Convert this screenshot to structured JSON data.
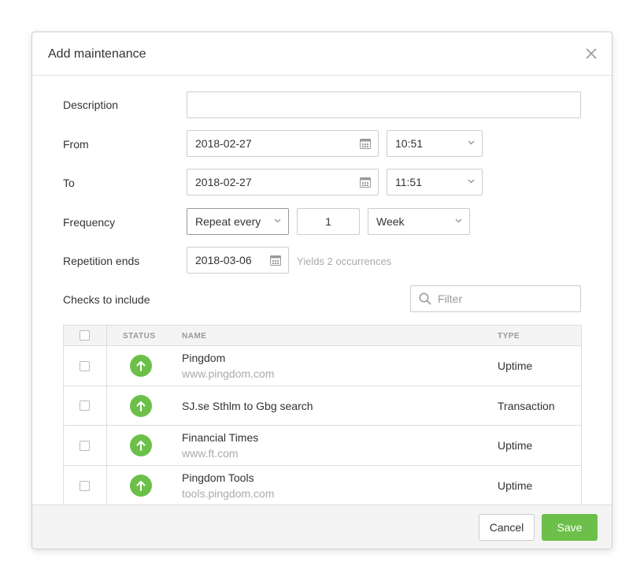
{
  "dialog": {
    "title": "Add maintenance"
  },
  "form": {
    "description": {
      "label": "Description",
      "value": ""
    },
    "from": {
      "label": "From",
      "date": "2018-02-27",
      "time": "10:51"
    },
    "to": {
      "label": "To",
      "date": "2018-02-27",
      "time": "11:51"
    },
    "frequency": {
      "label": "Frequency",
      "mode": "Repeat every",
      "count": "1",
      "unit": "Week"
    },
    "repetition_ends": {
      "label": "Repetition ends",
      "date": "2018-03-06",
      "hint": "Yields 2 occurrences"
    },
    "checks": {
      "label": "Checks to include",
      "filter_placeholder": "Filter"
    }
  },
  "table": {
    "columns": [
      "STATUS",
      "NAME",
      "TYPE"
    ],
    "rows": [
      {
        "name": "Pingdom",
        "url": "www.pingdom.com",
        "type": "Uptime",
        "status": "up"
      },
      {
        "name": "SJ.se Sthlm to Gbg search",
        "url": "",
        "type": "Transaction",
        "status": "up"
      },
      {
        "name": "Financial Times",
        "url": "www.ft.com",
        "type": "Uptime",
        "status": "up"
      },
      {
        "name": "Pingdom Tools",
        "url": "tools.pingdom.com",
        "type": "Uptime",
        "status": "up"
      }
    ]
  },
  "footer": {
    "cancel_label": "Cancel",
    "save_label": "Save"
  },
  "colors": {
    "accent": "#6cc04a",
    "border": "#cccccc",
    "muted_text": "#aaaaaa"
  },
  "icons": [
    "close-icon",
    "calendar-icon",
    "chevron-down-icon",
    "search-icon",
    "arrow-up-icon"
  ]
}
